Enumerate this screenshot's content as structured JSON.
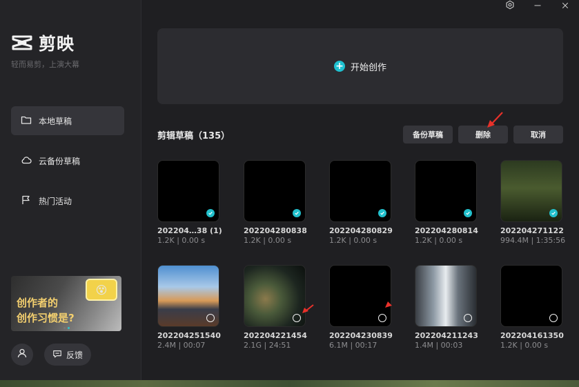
{
  "app": {
    "name": "剪映",
    "slogan": "轻而易剪，上演大幕"
  },
  "sidebar": {
    "items": [
      {
        "label": "本地草稿",
        "icon": "folder-icon",
        "active": true
      },
      {
        "label": "云备份草稿",
        "icon": "cloud-icon",
        "active": false
      },
      {
        "label": "热门活动",
        "icon": "flag-icon",
        "active": false
      }
    ],
    "banner": {
      "line1": "创作者的",
      "line2": "创作习惯是?"
    },
    "feedback_label": "反馈"
  },
  "main": {
    "start_label": "开始创作",
    "section_title": "剪辑草稿（135）",
    "buttons": {
      "backup": "备份草稿",
      "delete": "删除",
      "cancel": "取消"
    },
    "drafts": [
      {
        "name": "202204…38 (1)",
        "meta": "1.2K | 0.00 s",
        "selected": true,
        "thumb": "black"
      },
      {
        "name": "202204280838",
        "meta": "1.2K | 0.00 s",
        "selected": true,
        "thumb": "black"
      },
      {
        "name": "202204280829",
        "meta": "1.2K | 0.00 s",
        "selected": true,
        "thumb": "black"
      },
      {
        "name": "202204280814",
        "meta": "1.2K | 0.00 s",
        "selected": true,
        "thumb": "black"
      },
      {
        "name": "202204271122",
        "meta": "994.4M | 1:35:56",
        "selected": true,
        "thumb": "forest"
      },
      {
        "name": "202204251540",
        "meta": "2.4M | 00:07",
        "selected": false,
        "thumb": "sunset"
      },
      {
        "name": "202204221454",
        "meta": "2.1G | 24:51",
        "selected": false,
        "thumb": "voxel"
      },
      {
        "name": "202204230839",
        "meta": "6.1M | 00:17",
        "selected": false,
        "thumb": "black"
      },
      {
        "name": "202204211243",
        "meta": "1.4M | 00:03",
        "selected": false,
        "thumb": "street"
      },
      {
        "name": "202204161350",
        "meta": "1.2K | 0.00 s",
        "selected": false,
        "thumb": "black"
      }
    ]
  },
  "colors": {
    "accent": "#22c0cc",
    "background": "#1f1f22",
    "sidebar": "#242427",
    "arrow": "#e8312a"
  }
}
